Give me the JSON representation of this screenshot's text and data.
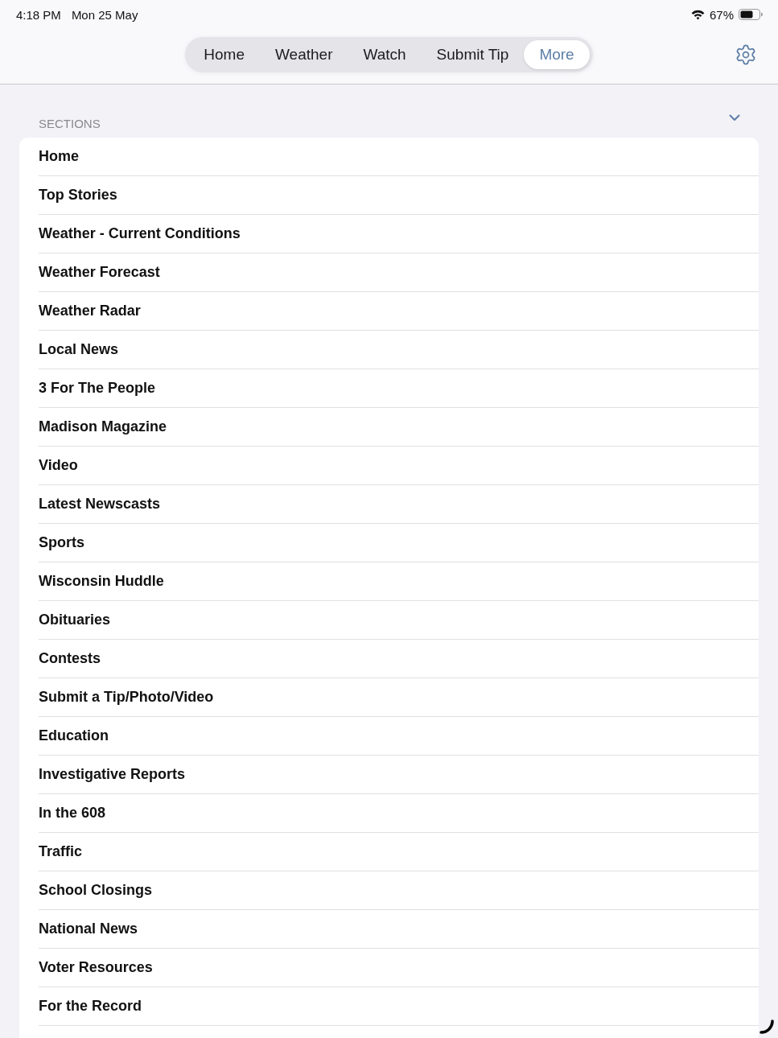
{
  "status_bar": {
    "time": "4:18 PM",
    "date": "Mon 25 May",
    "battery": "67%"
  },
  "tabs": [
    {
      "label": "Home",
      "selected": false
    },
    {
      "label": "Weather",
      "selected": false
    },
    {
      "label": "Watch",
      "selected": false
    },
    {
      "label": "Submit Tip",
      "selected": false
    },
    {
      "label": "More",
      "selected": true
    }
  ],
  "sections": {
    "title": "SECTIONS",
    "expanded": true,
    "items": [
      "Home",
      "Top Stories",
      "Weather - Current Conditions",
      "Weather Forecast",
      "Weather Radar",
      "Local News",
      "3 For The People",
      "Madison Magazine",
      "Video",
      "Latest Newscasts",
      "Sports",
      "Wisconsin Huddle",
      "Obituaries",
      "Contests",
      "Submit a Tip/Photo/Video",
      "Education",
      "Investigative Reports",
      "In the 608",
      "Traffic",
      "School Closings",
      "National News",
      "Voter Resources",
      "For the Record"
    ]
  }
}
